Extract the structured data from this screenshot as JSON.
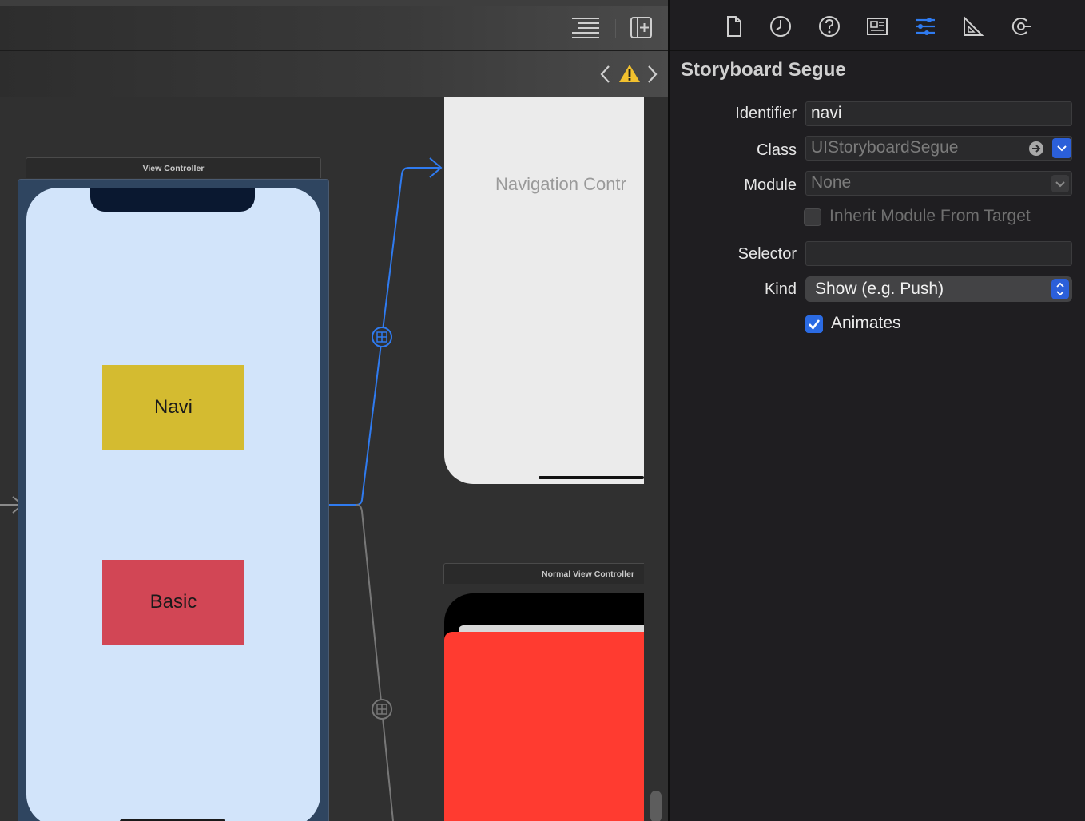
{
  "toolbar": {
    "icons": [
      "editor-options-icon",
      "add-editor-icon"
    ]
  },
  "jump_bar": {
    "icons": [
      "back-chevron-icon",
      "warning-icon",
      "forward-chevron-icon"
    ]
  },
  "canvas": {
    "view_controller": {
      "header": "View Controller",
      "buttons": [
        {
          "label": "Navi",
          "color": "#d4bb30"
        },
        {
          "label": "Basic",
          "color": "#d24655"
        }
      ]
    },
    "navigation_controller": {
      "title": "Navigation Contr"
    },
    "normal_view_controller": {
      "header": "Normal View Controller"
    }
  },
  "inspector": {
    "tabs": [
      {
        "name": "file-inspector-icon",
        "active": false
      },
      {
        "name": "history-inspector-icon",
        "active": false
      },
      {
        "name": "help-inspector-icon",
        "active": false
      },
      {
        "name": "identity-inspector-icon",
        "active": false
      },
      {
        "name": "attributes-inspector-icon",
        "active": true
      },
      {
        "name": "size-inspector-icon",
        "active": false
      },
      {
        "name": "connections-inspector-icon",
        "active": false
      }
    ],
    "title": "Storyboard Segue",
    "identifier": {
      "label": "Identifier",
      "value": "navi"
    },
    "class": {
      "label": "Class",
      "value": "UIStoryboardSegue"
    },
    "module": {
      "label": "Module",
      "value": "None"
    },
    "inherit_module": {
      "label": "Inherit Module From Target",
      "checked": false
    },
    "selector": {
      "label": "Selector",
      "value": ""
    },
    "kind": {
      "label": "Kind",
      "value": "Show (e.g. Push)"
    },
    "animates": {
      "label": "Animates",
      "checked": true
    }
  },
  "colors": {
    "accent": "#2b6be3",
    "segue_selected": "#2f7bf0",
    "segue_normal": "#7a7a7a",
    "normal_vc_red": "#ff3b30"
  }
}
